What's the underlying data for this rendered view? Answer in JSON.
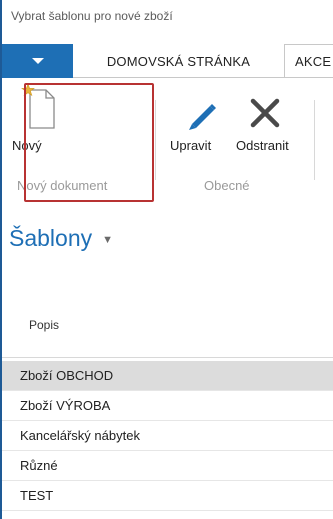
{
  "window": {
    "title": "Vybrat šablonu pro nové zboží"
  },
  "tabs": [
    {
      "label": "DOMOVSKÁ STRÁNKA"
    },
    {
      "label": "AKCE"
    }
  ],
  "ribbon": {
    "new_label": "Nový",
    "edit_label": "Upravit",
    "delete_label": "Odstranit",
    "group_new_label": "Nový dokument",
    "group_common_label": "Obecné"
  },
  "section": {
    "title": "Šablony"
  },
  "table": {
    "column_header": "Popis",
    "rows": [
      {
        "label": "Zboží OBCHOD",
        "selected": true
      },
      {
        "label": "Zboží VÝROBA",
        "selected": false
      },
      {
        "label": "Kancelářský nábytek",
        "selected": false
      },
      {
        "label": "Různé",
        "selected": false
      },
      {
        "label": "TEST",
        "selected": false
      }
    ]
  },
  "colors": {
    "accent": "#1e6fb5",
    "highlight": "#b83232",
    "selected_row": "#dcdcdc"
  },
  "icons": {
    "menu": "caret-down-icon",
    "new": "new-document-icon",
    "edit": "pencil-icon",
    "delete": "close-x-icon"
  }
}
